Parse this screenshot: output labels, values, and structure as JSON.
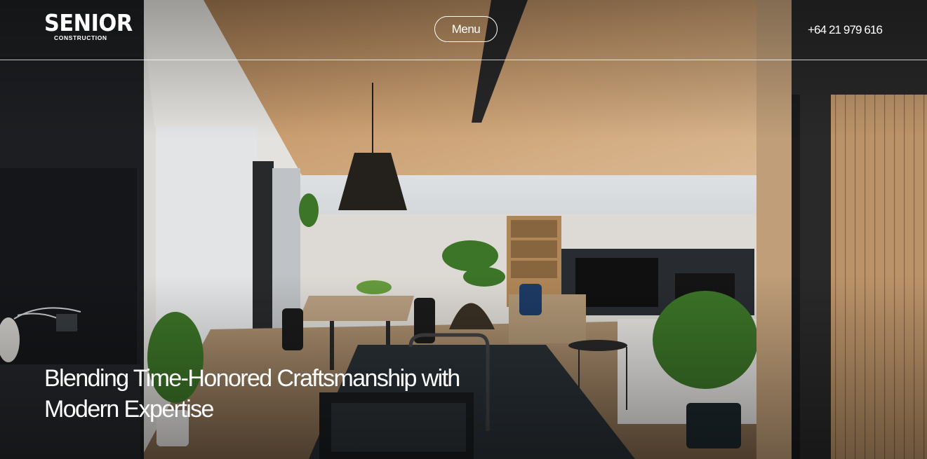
{
  "brand": {
    "name": "SENIOR",
    "tagline": "CONSTRUCTION"
  },
  "nav": {
    "menu_label": "Menu",
    "phone": "+64 21 979 616"
  },
  "hero": {
    "headline_line1": "Blending Time-Honored Craftsmanship with",
    "headline_line2": "Modern Expertise"
  },
  "colors": {
    "text": "#ffffff",
    "ceiling": "#c79a6b",
    "cabinet": "#1e2023",
    "wood_wall": "#c8a27a"
  }
}
